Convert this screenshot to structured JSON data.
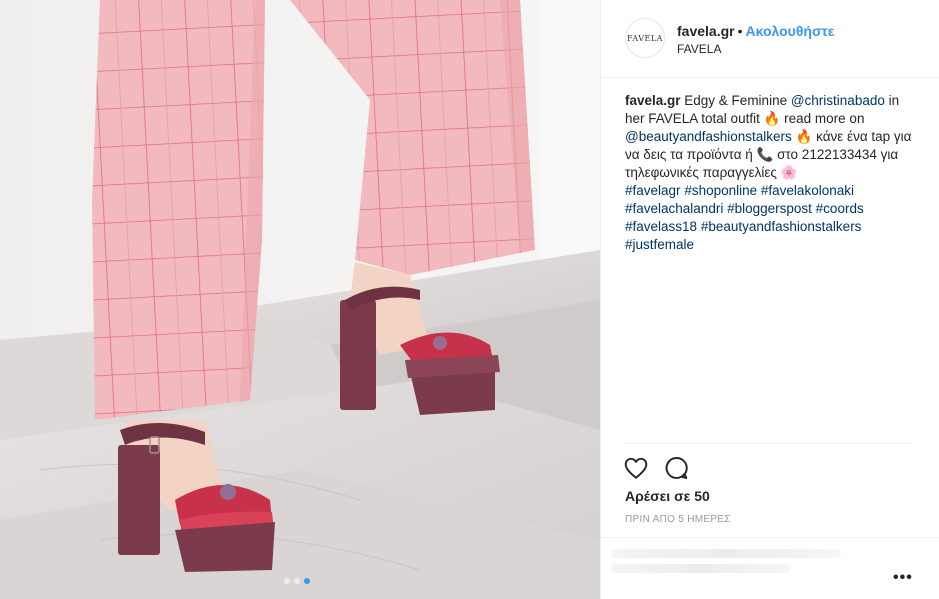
{
  "post": {
    "username": "favela.gr",
    "separator": "•",
    "follow_label": "Ακολουθήστε",
    "location": "FAVELA",
    "avatar_text": "FAVELA"
  },
  "caption": {
    "user": "favela.gr",
    "text_1": " Edgy & Feminine ",
    "mention_1": "@christinabado",
    "text_2": " in her FAVELA total outfit ",
    "emoji_fire": "🔥",
    "text_3": " read more on ",
    "mention_2": "@beautyandfashionstalkers",
    "text_4": " κάνε ένα tap για να δεις τα προϊόντα ή ",
    "emoji_phone": "📞",
    "text_5": " στο 2122133434 για τηλεφωνικές παραγγελίες ",
    "emoji_flower": "🌸",
    "hashtags": [
      "#favelagr",
      "#shoponline",
      "#favelakolonaki",
      "#favelachalandri",
      "#bloggerspost",
      "#coords",
      "#favelass18",
      "#beautyandfashionstalkers",
      "#justfemale"
    ]
  },
  "actions": {
    "like_icon": "heart-outline-icon",
    "comment_icon": "comment-bubble-icon",
    "likes_text": "Αρέσει σε 50",
    "timestamp": "ΠΡΙΝ ΑΠΟ 5 ΗΜΕΡΕΣ",
    "more_label": "•••"
  },
  "carousel": {
    "count": 3,
    "active_index": 2
  },
  "colors": {
    "accent": "#3897f0",
    "link": "#003569",
    "text": "#262626",
    "muted": "#999999",
    "trouser_pink": "#f2b6bd",
    "shoe_suede": "#7c3b4c"
  }
}
